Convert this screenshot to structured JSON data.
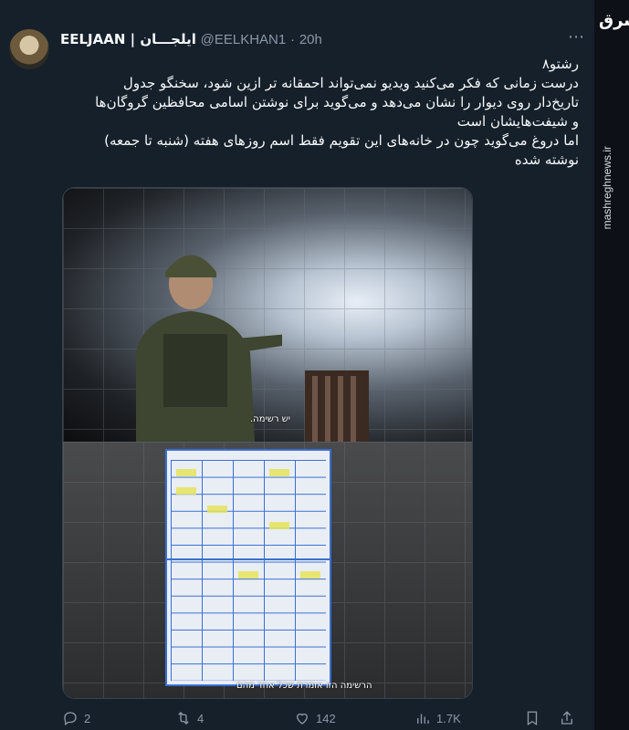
{
  "author": {
    "name": "EELJAAN | ایلجـــان",
    "handle": "@EELKHAN1",
    "separator": "·",
    "time": "20h"
  },
  "tweet": {
    "lines": [
      "رشتو۸",
      "درست زمانی که فکر می‌کنید ویدیو نمی‌تواند احمقانه تر ازین شود، سخنگو جدول",
      "تاریخ‌دار روی دیوار را نشان می‌دهد و می‌گوید برای نوشتن اسامی محافظین گروگان‌ها",
      "و شیفت‌هایشان است",
      "اما دروغ می‌گوید چون در خانه‌های این تقویم فقط اسم روزهای هفته (شنبه تا جمعه)",
      "نوشته شده"
    ]
  },
  "media": {
    "top_subtitle": "יש רשימה.",
    "bottom_subtitle": "הרשימה הזו אומרת שכל אחד מהם"
  },
  "actions": {
    "replies": "2",
    "retweets": "4",
    "likes": "142",
    "views": "1.7K"
  },
  "watermark": {
    "logo": "مشرق",
    "site": "mashreghnews.ir"
  },
  "colors": {
    "background": "#15202b",
    "muted": "#8b98a5",
    "text": "#f7f9f9"
  }
}
